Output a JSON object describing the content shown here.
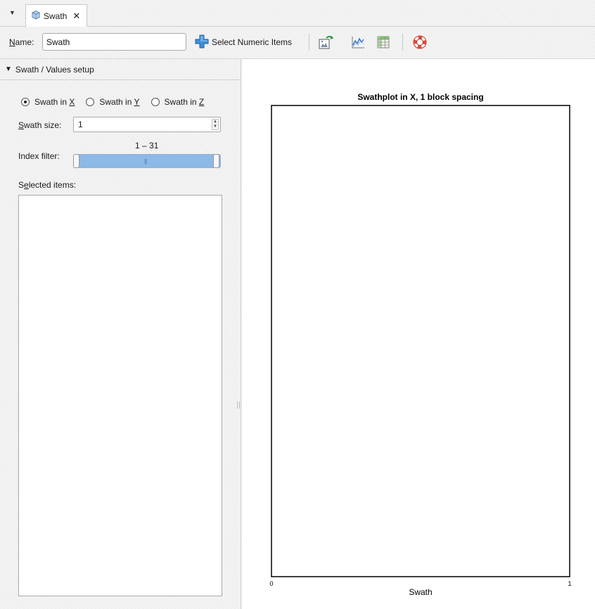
{
  "tab": {
    "menu_glyph": "▼",
    "label": "Swath",
    "icon": "block-model-icon",
    "close_glyph": "✕"
  },
  "toolbar": {
    "name_label": "Name:",
    "name_value": "Swath",
    "select_label": "Select Numeric Items",
    "icons": [
      "select-add-icon",
      "export-image-icon",
      "chart-icon",
      "table-icon",
      "help-lifebuoy-icon"
    ]
  },
  "panel": {
    "section_title": "Swath / Values setup",
    "section_glyph": "▼",
    "radios": [
      {
        "prefix": "Swath in ",
        "key": "X",
        "selected": true
      },
      {
        "prefix": "Swath in ",
        "key": "Y",
        "selected": false
      },
      {
        "prefix": "Swath in ",
        "key": "Z",
        "selected": false
      }
    ],
    "swath_size_label_key": "S",
    "swath_size_label_rest": "wath size:",
    "swath_size_value": "1",
    "index_filter_label": "Index filter:",
    "range_text": "1 – 31",
    "range_min": 1,
    "range_max": 31,
    "range_low": 1,
    "range_high": 31,
    "selected_items_label_pre": "S",
    "selected_items_label_key": "e",
    "selected_items_label_rest": "lected items:"
  },
  "chart_data": {
    "type": "line",
    "title": "Swathplot in X, 1 block spacing",
    "xlabel": "Swath",
    "ylabel": "",
    "xlim": [
      0,
      1
    ],
    "x_ticks": [
      "0",
      "1"
    ],
    "series": []
  }
}
